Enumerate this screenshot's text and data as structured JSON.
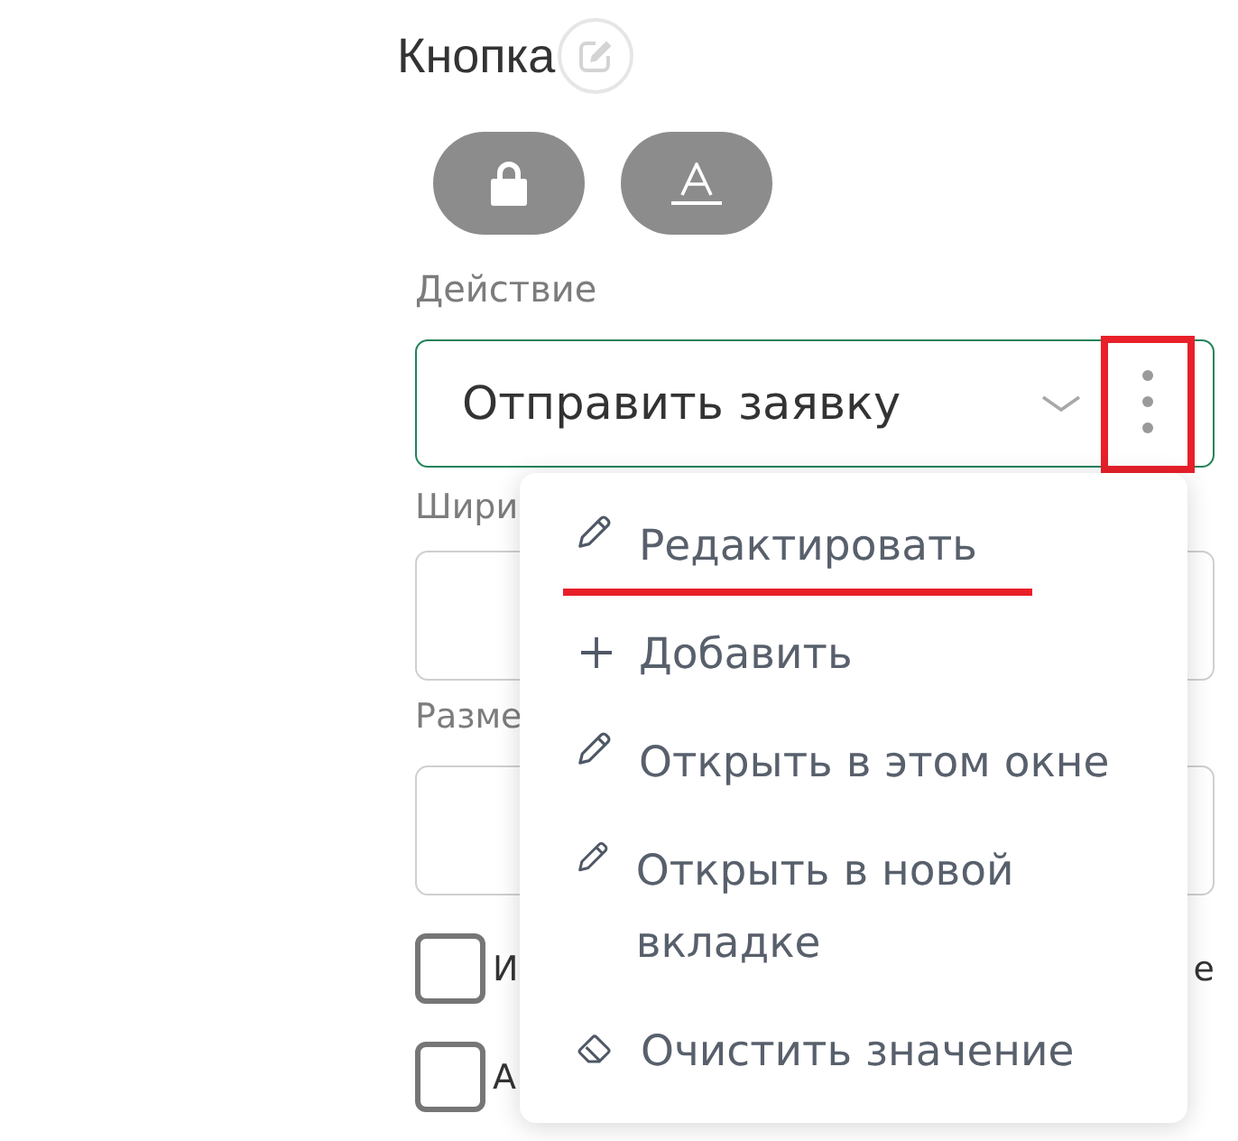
{
  "header": {
    "title": "Кнопка"
  },
  "style_buttons": [
    {
      "kind": "lock"
    },
    {
      "kind": "font"
    }
  ],
  "action_field": {
    "label": "Действие",
    "value": "Отправить заявку",
    "more_highlighted": true
  },
  "context_menu": {
    "items": [
      {
        "kind": "pencil",
        "label": "Редактировать",
        "underlined": true
      },
      {
        "kind": "plus",
        "label": "Добавить",
        "underlined": false
      },
      {
        "kind": "pencil",
        "label": "Открыть в этом окне",
        "underlined": false
      },
      {
        "kind": "pencil",
        "label": "Открыть в новой вкладке",
        "underlined": false
      },
      {
        "kind": "eraser",
        "label": "Очистить значение",
        "underlined": false
      }
    ]
  },
  "fields": [
    {
      "label": "Шири"
    },
    {
      "label": "Разме"
    }
  ],
  "checkboxes": [
    {
      "label": "И",
      "label_end": "е",
      "checked": false
    },
    {
      "label": "А",
      "checked": false
    }
  ]
}
